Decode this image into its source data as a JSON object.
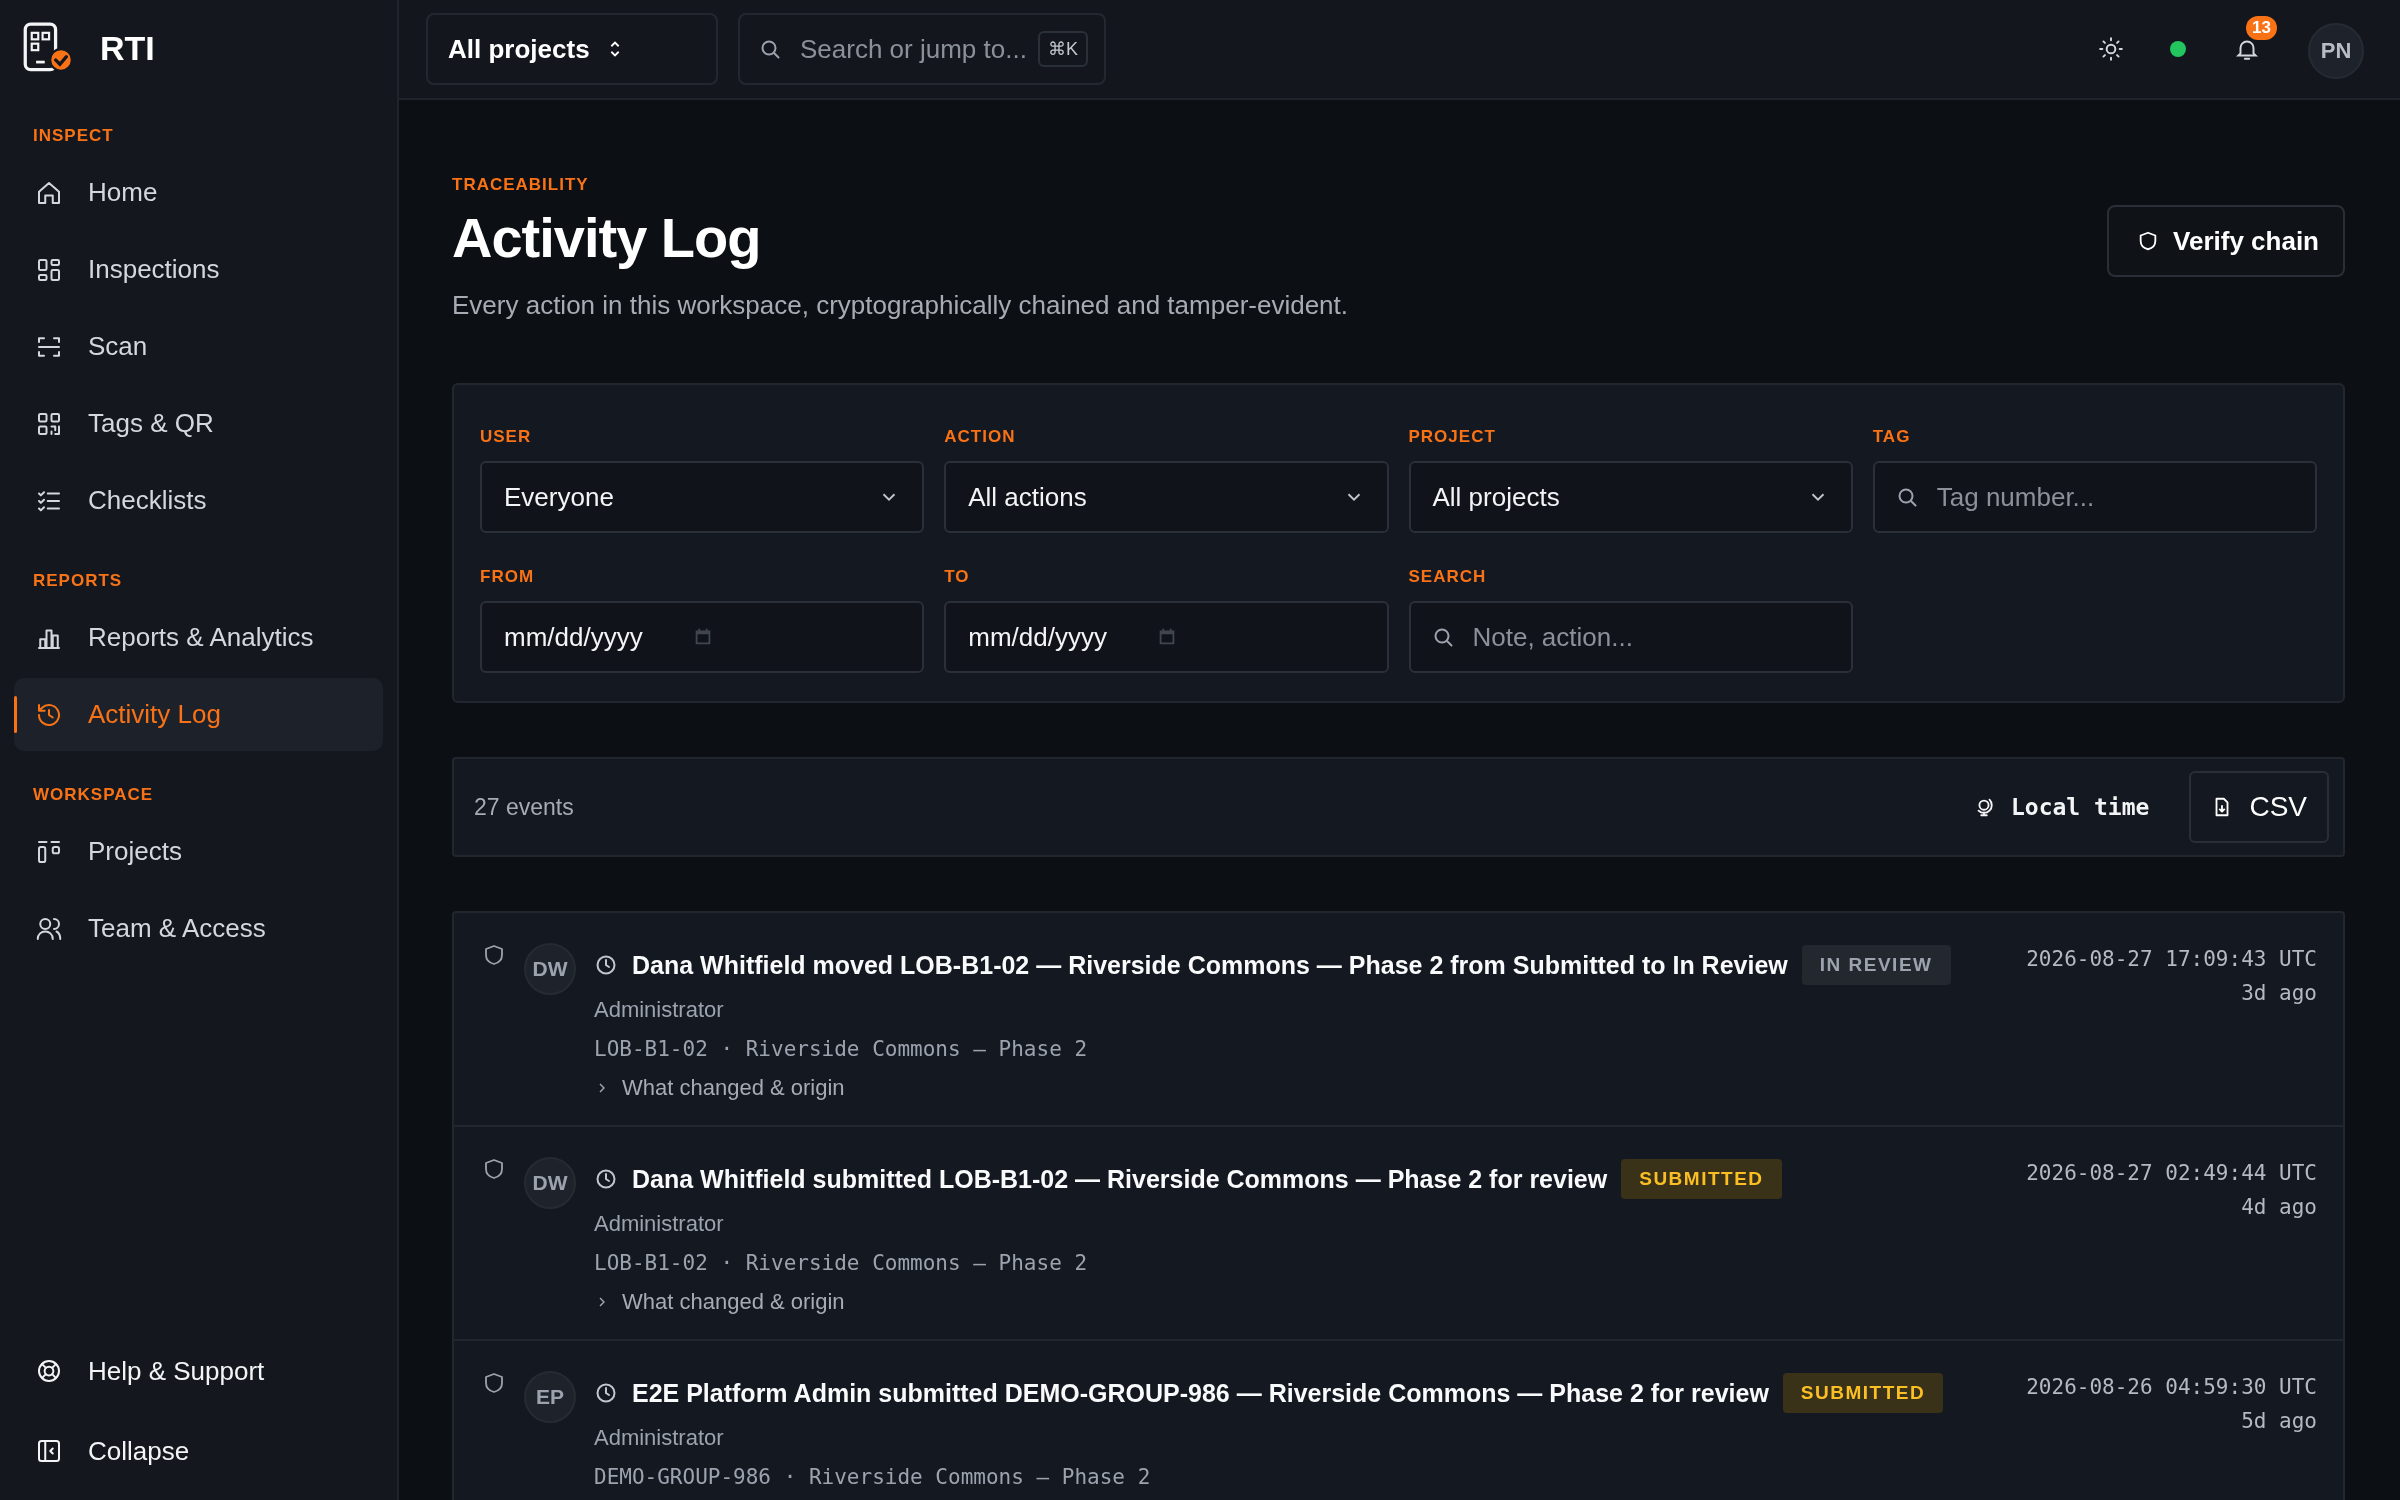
{
  "brand": {
    "name": "RTI"
  },
  "sidebar": {
    "sections": [
      {
        "label": "INSPECT",
        "items": [
          {
            "label": "Home",
            "selected": false
          },
          {
            "label": "Inspections",
            "selected": false
          },
          {
            "label": "Scan",
            "selected": false
          },
          {
            "label": "Tags & QR",
            "selected": false
          },
          {
            "label": "Checklists",
            "selected": false
          }
        ]
      },
      {
        "label": "REPORTS",
        "items": [
          {
            "label": "Reports & Analytics",
            "selected": false
          },
          {
            "label": "Activity Log",
            "selected": true
          }
        ]
      },
      {
        "label": "WORKSPACE",
        "items": [
          {
            "label": "Projects",
            "selected": false
          },
          {
            "label": "Team & Access",
            "selected": false
          }
        ]
      }
    ],
    "footer": [
      "Help & Support",
      "Collapse"
    ]
  },
  "topbar": {
    "project": "All projects",
    "search": {
      "placeholder": "Search or jump to...",
      "shortcut": "⌘K"
    },
    "notifications": "13",
    "avatar": "PN"
  },
  "header": {
    "eyebrow": "TRACEABILITY",
    "title": "Activity Log",
    "subtitle": "Every action in this workspace, cryptographically chained and tamper-evident.",
    "action": "Verify chain"
  },
  "filters": [
    {
      "kind": "select",
      "label": "USER",
      "value": "Everyone"
    },
    {
      "kind": "select",
      "label": "ACTION",
      "value": "All actions"
    },
    {
      "kind": "select",
      "label": "PROJECT",
      "value": "All projects"
    },
    {
      "kind": "search",
      "label": "TAG",
      "placeholder": "Tag number..."
    },
    {
      "kind": "date",
      "label": "FROM",
      "placeholder": "mm/dd/yyyy"
    },
    {
      "kind": "date",
      "label": "TO",
      "placeholder": "mm/dd/yyyy"
    },
    {
      "kind": "search",
      "label": "SEARCH",
      "placeholder": "Note, action..."
    }
  ],
  "toolbar": {
    "count": "27 events",
    "time_toggle": "Local time",
    "export": "CSV"
  },
  "events": [
    {
      "initials": "DW",
      "title": "Dana Whitfield moved LOB-B1-02 — Riverside Commons — Phase 2 from Submitted to In Review",
      "status": {
        "kind": "review",
        "label": "IN REVIEW"
      },
      "role": "Administrator",
      "ref": "LOB-B1-02 · Riverside Commons — Phase 2",
      "details": "What changed & origin",
      "timestamp": "2026-08-27 17:09:43 UTC",
      "ago": "3d ago"
    },
    {
      "initials": "DW",
      "title": "Dana Whitfield submitted LOB-B1-02 — Riverside Commons — Phase 2 for review",
      "status": {
        "kind": "submitted",
        "label": "SUBMITTED"
      },
      "role": "Administrator",
      "ref": "LOB-B1-02 · Riverside Commons — Phase 2",
      "details": "What changed & origin",
      "timestamp": "2026-08-27 02:49:44 UTC",
      "ago": "4d ago"
    },
    {
      "initials": "EP",
      "title": "E2E Platform Admin submitted DEMO-GROUP-986 — Riverside Commons — Phase 2 for review",
      "status": {
        "kind": "submitted",
        "label": "SUBMITTED"
      },
      "role": "Administrator",
      "ref": "DEMO-GROUP-986 · Riverside Commons — Phase 2",
      "timestamp": "2026-08-26 04:59:30 UTC",
      "ago": "5d ago"
    }
  ]
}
